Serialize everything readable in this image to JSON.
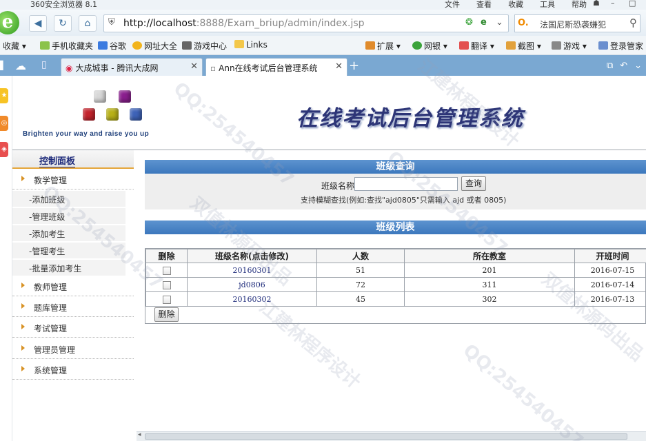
{
  "browser": {
    "app_title": "360安全浏览器 8.1",
    "menu": [
      "文件",
      "查看",
      "收藏",
      "工具",
      "帮助"
    ],
    "url_host": "http://localhost",
    "url_rest": ":8888/Exam_briup/admin/index.jsp",
    "search_text": "法国尼斯恐袭嫌犯",
    "bookmarks": [
      "收藏",
      "手机收藏夹",
      "谷歌",
      "网址大全",
      "游戏中心",
      "Links",
      "扩展",
      "网银",
      "翻译",
      "截图",
      "游戏",
      "登录管家"
    ],
    "tabs": [
      {
        "label": "大成城事 - 腾讯大成网"
      },
      {
        "label": "Ann在线考试后台管理系统"
      }
    ],
    "new_tab": "+"
  },
  "header": {
    "slogan": "Brighten your way and raise you up",
    "title": "在线考试后台管理系统"
  },
  "sidebar": {
    "panel_title": "控制面板",
    "categories": [
      {
        "label": "教学管理"
      },
      {
        "label": "教师管理"
      },
      {
        "label": "题库管理"
      },
      {
        "label": "考试管理"
      },
      {
        "label": "管理员管理"
      },
      {
        "label": "系统管理"
      }
    ],
    "sub_items": [
      {
        "label": "-添加班级"
      },
      {
        "label": "-管理班级"
      },
      {
        "label": "-添加考生"
      },
      {
        "label": "-管理考生"
      },
      {
        "label": "-批量添加考生"
      }
    ]
  },
  "query": {
    "title": "班级查询",
    "label": "班级名称:",
    "input_value": "",
    "button": "查询",
    "hint": "支持模糊查找(例如:查找\"ajd0805\"只需输入 ajd 或者 0805)"
  },
  "list": {
    "title": "班级列表",
    "columns": [
      "删除",
      "班级名称(点击修改)",
      "人数",
      "所在教室",
      "开班时间"
    ],
    "rows": [
      {
        "name": "20160301",
        "count": "51",
        "room": "201",
        "date": "2016-07-15"
      },
      {
        "name": "jd0806",
        "count": "72",
        "room": "311",
        "date": "2016-07-14"
      },
      {
        "name": "20160302",
        "count": "45",
        "room": "302",
        "date": "2016-07-13"
      }
    ],
    "delete_button": "删除"
  },
  "watermarks": [
    "QQ:254540457",
    "双值林源码出品",
    "江建林程序设计"
  ]
}
